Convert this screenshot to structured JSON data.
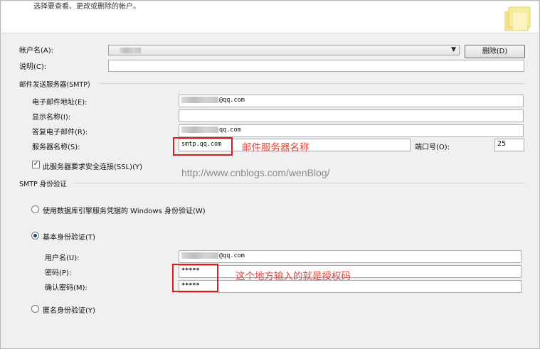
{
  "header": {
    "description": "选择要查看、更改或删除的帐户。"
  },
  "account": {
    "name_label": "帐户名(A):",
    "description_label": "说明(C):",
    "delete_button": "删除(D)"
  },
  "smtp": {
    "section_title": "邮件发送服务器(SMTP)",
    "email_label": "电子邮件地址(E):",
    "email_value": "@qq.com",
    "display_name_label": "显示名称(I):",
    "reply_label": "答复电子邮件(R):",
    "reply_value": "qq.com",
    "server_label": "服务器名称(S):",
    "server_value": "smtp.qq.com",
    "port_label": "端口号(O):",
    "port_value": "25",
    "ssl_label": "此服务器要求安全连接(SSL)(Y)",
    "ssl_checked": true
  },
  "auth": {
    "section_title": "SMTP 身份验证",
    "windows_option": "使用数据库引擎服务凭据的 Windows 身份验证(W)",
    "basic_option": "基本身份验证(T)",
    "username_label": "用户名(U):",
    "username_value": "@qq.com",
    "password_label": "密码(P):",
    "password_value": "*****",
    "confirm_label": "确认密码(M):",
    "confirm_value": "*****",
    "anonymous_option": "匿名身份验证(Y)",
    "selected": "basic"
  },
  "annotations": {
    "server_note": "邮件服务器名称",
    "password_note": "这个地方输入的就是授权码",
    "watermark": "http://www.cnblogs.com/wenBlog/",
    "color": "#e0463a"
  }
}
